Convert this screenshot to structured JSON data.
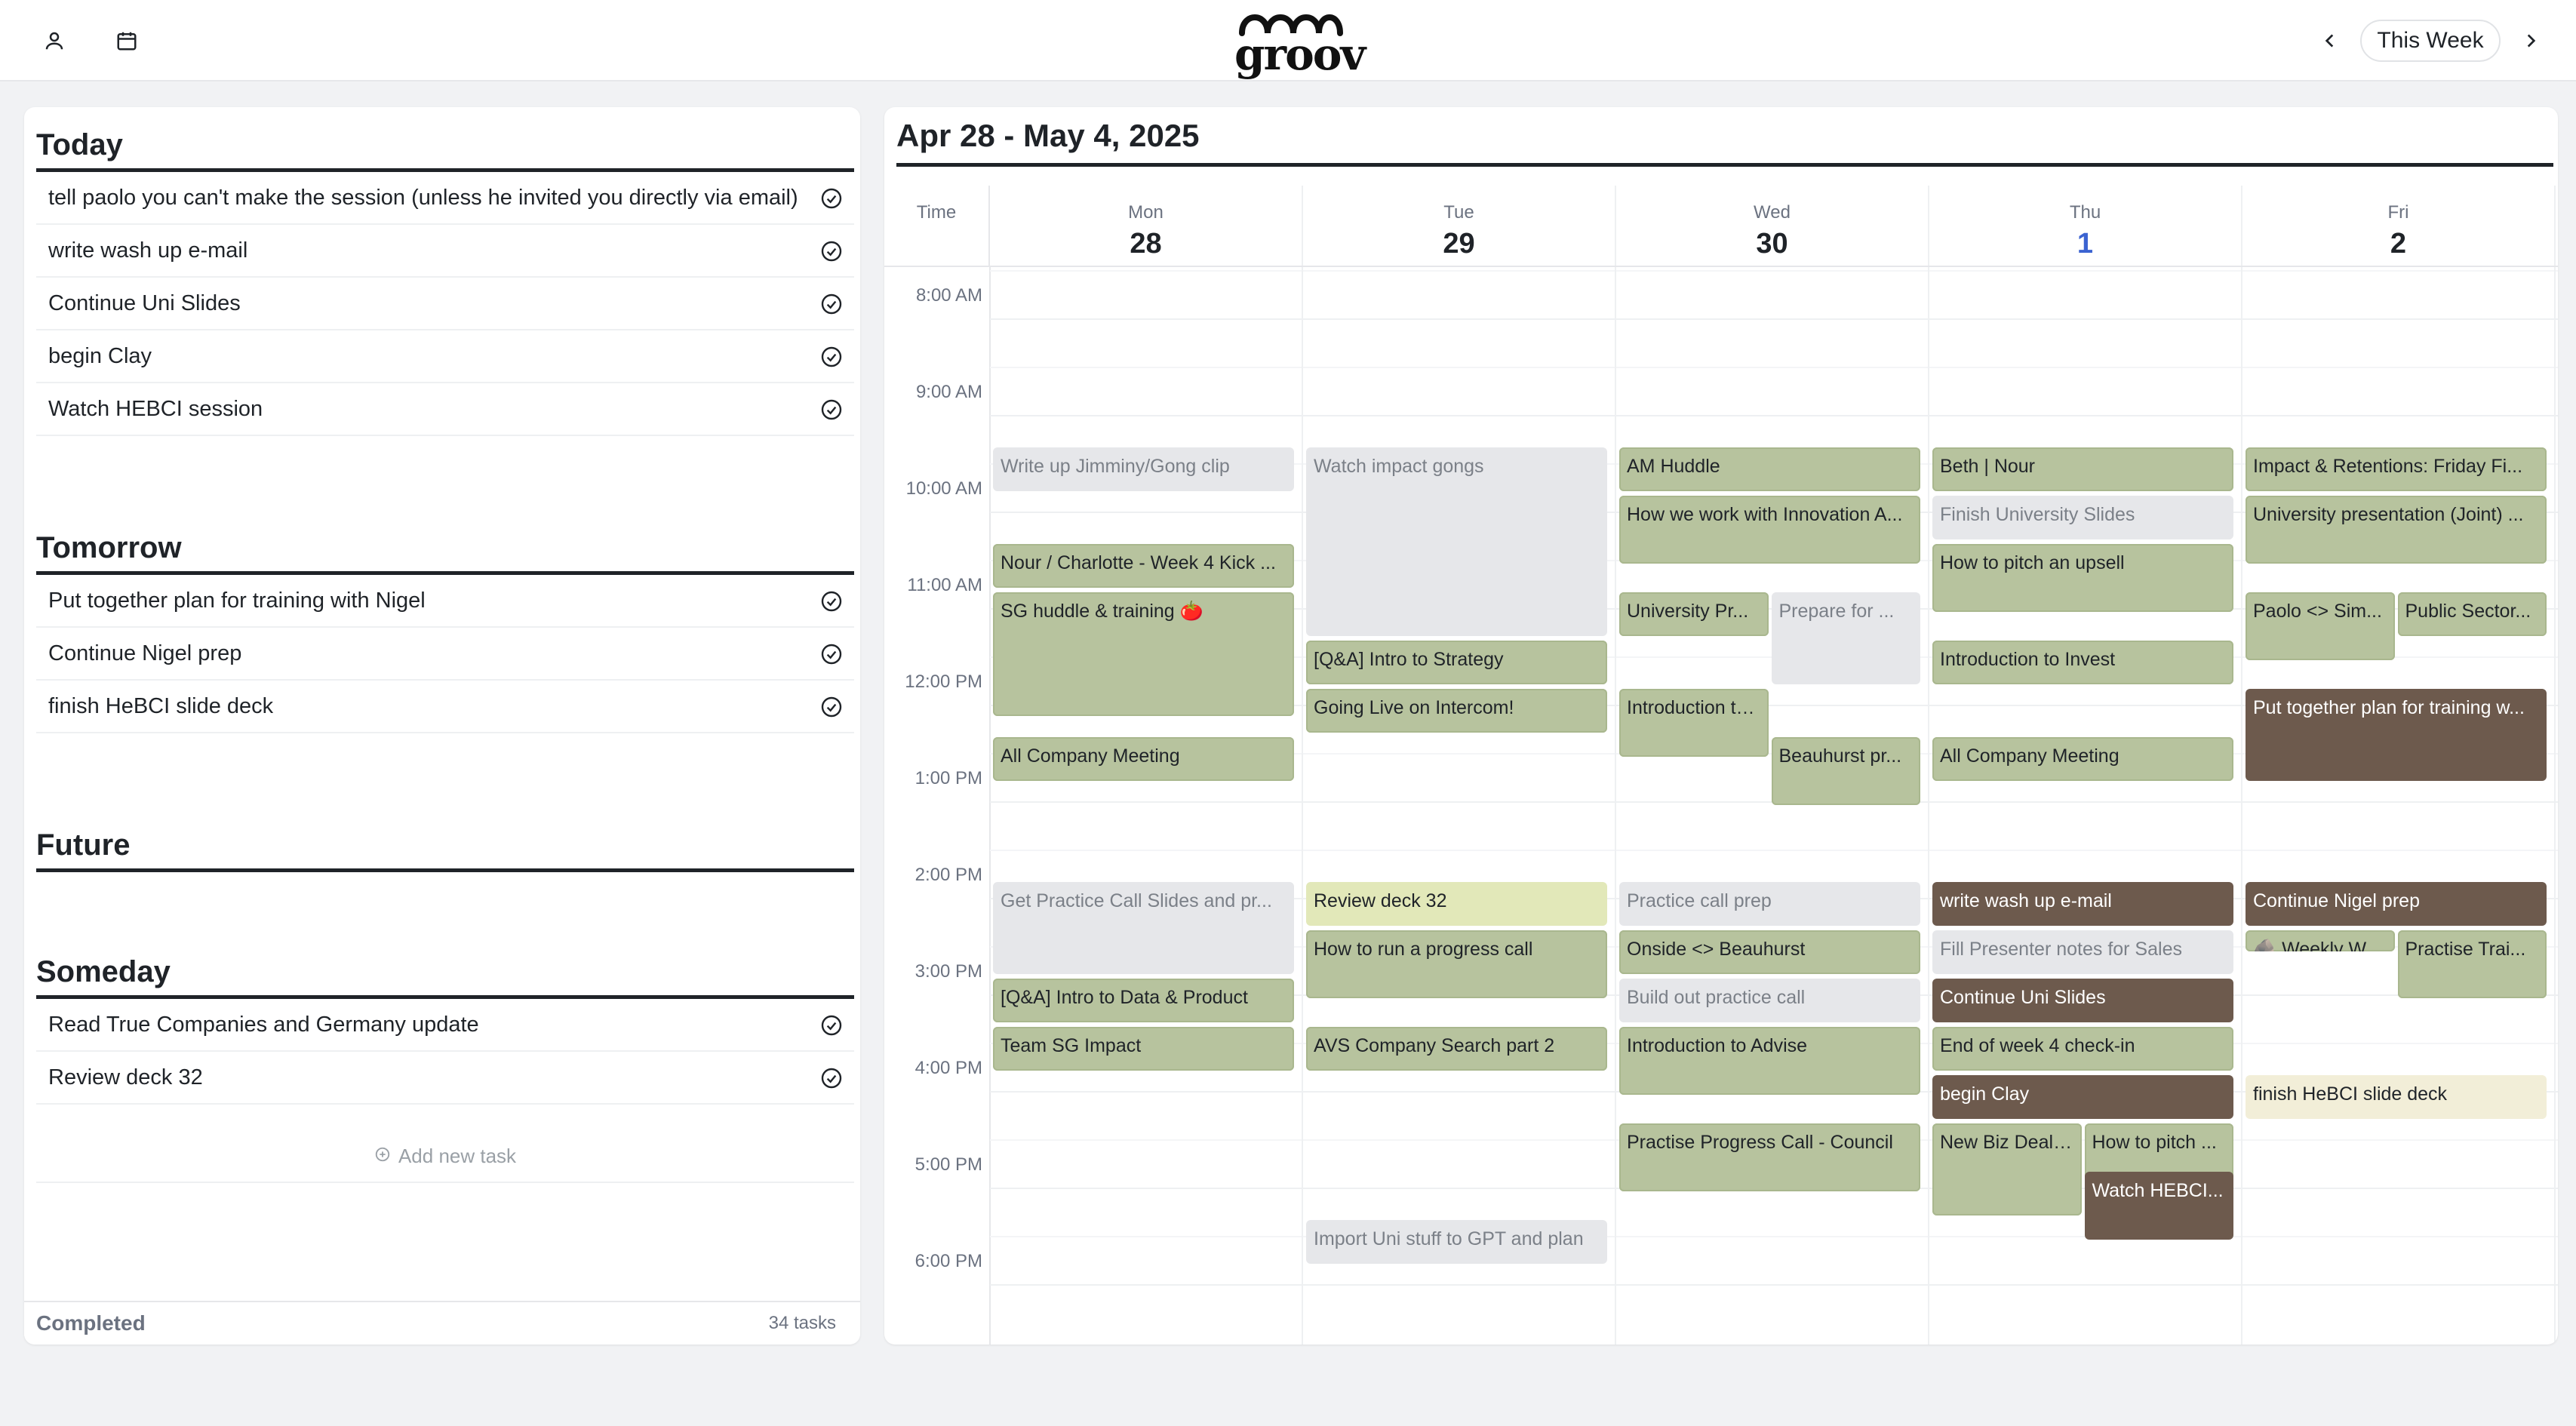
{
  "topbar": {
    "logo_text": "groov",
    "week_button": "This Week"
  },
  "colors": {
    "event_green": "#b7c39e",
    "event_gray": "#e6e7ea",
    "event_brown": "#6d5a4d",
    "event_yellow": "#e2e8b9",
    "event_cream": "#f2eed8",
    "today_accent": "#3b63d1"
  },
  "icons": {
    "profile": "person-icon",
    "calendar": "calendar-icon",
    "prev": "chevron-left-icon",
    "next": "chevron-right-icon",
    "task_check": "check-circle-icon",
    "add": "plus-circle-icon"
  },
  "tasks": {
    "today": {
      "title": "Today",
      "items": [
        "tell paolo you can't make the session (unless he invited you directly via email)",
        "write wash up e-mail",
        "Continue Uni Slides",
        "begin Clay",
        "Watch HEBCI session"
      ]
    },
    "tomorrow": {
      "title": "Tomorrow",
      "items": [
        "Put together plan for training with Nigel",
        "Continue Nigel prep",
        "finish HeBCI slide deck"
      ]
    },
    "future": {
      "title": "Future",
      "items": []
    },
    "someday": {
      "title": "Someday",
      "items": [
        "Read True Companies and Germany update",
        "Review deck 32"
      ]
    },
    "add_task_label": "Add new task",
    "completed_label": "Completed",
    "completed_count": "34 tasks"
  },
  "calendar": {
    "range_title": "Apr 28 - May 4, 2025",
    "time_header": "Time",
    "days": [
      {
        "name": "Mon",
        "num": "28"
      },
      {
        "name": "Tue",
        "num": "29"
      },
      {
        "name": "Wed",
        "num": "30"
      },
      {
        "name": "Thu",
        "num": "1"
      },
      {
        "name": "Fri",
        "num": "2"
      }
    ],
    "hours": [
      "8:00 AM",
      "9:00 AM",
      "10:00 AM",
      "11:00 AM",
      "12:00 PM",
      "1:00 PM",
      "2:00 PM",
      "3:00 PM",
      "4:00 PM",
      "5:00 PM",
      "6:00 PM"
    ],
    "events": [
      {
        "day": "Mon",
        "start": "9:00",
        "end": "9:30",
        "title": "Write up Jimminy/Gong clip",
        "color": "gray"
      },
      {
        "day": "Mon",
        "start": "10:00",
        "end": "10:30",
        "title": "Nour / Charlotte - Week 4 Kick ...",
        "color": "green"
      },
      {
        "day": "Mon",
        "start": "10:30",
        "end": "11:50",
        "title": "SG huddle & training 🍅",
        "color": "green"
      },
      {
        "day": "Mon",
        "start": "12:00",
        "end": "12:30",
        "title": "All Company Meeting",
        "color": "green"
      },
      {
        "day": "Mon",
        "start": "13:30",
        "end": "14:30",
        "title": "Get Practice Call Slides and pr...",
        "color": "gray"
      },
      {
        "day": "Mon",
        "start": "14:30",
        "end": "15:00",
        "title": "[Q&A] Intro to Data & Product",
        "color": "green"
      },
      {
        "day": "Mon",
        "start": "15:00",
        "end": "15:30",
        "title": "Team SG Impact",
        "color": "green"
      },
      {
        "day": "Tue",
        "start": "9:00",
        "end": "11:00",
        "title": "Watch impact gongs",
        "color": "gray"
      },
      {
        "day": "Tue",
        "start": "11:00",
        "end": "11:30",
        "title": "[Q&A] Intro to Strategy",
        "color": "green"
      },
      {
        "day": "Tue",
        "start": "11:30",
        "end": "12:00",
        "title": "Going Live on Intercom!",
        "color": "green"
      },
      {
        "day": "Tue",
        "start": "13:30",
        "end": "14:00",
        "title": "Review deck 32",
        "color": "yellow"
      },
      {
        "day": "Tue",
        "start": "14:00",
        "end": "14:45",
        "title": "How to run a progress call",
        "color": "green"
      },
      {
        "day": "Tue",
        "start": "15:00",
        "end": "15:30",
        "title": "AVS Company Search part 2",
        "color": "green"
      },
      {
        "day": "Tue",
        "start": "17:00",
        "end": "17:30",
        "title": "Import Uni stuff to GPT and plan",
        "color": "gray"
      },
      {
        "day": "Wed",
        "start": "9:00",
        "end": "9:30",
        "title": "AM Huddle",
        "color": "green"
      },
      {
        "day": "Wed",
        "start": "9:30",
        "end": "10:15",
        "title": "How we work with Innovation A...",
        "color": "green"
      },
      {
        "day": "Wed",
        "start": "10:30",
        "end": "11:00",
        "title": "University Pr...",
        "color": "green"
      },
      {
        "day": "Wed",
        "start": "10:30",
        "end": "11:30",
        "title": "Prepare for ...",
        "color": "gray"
      },
      {
        "day": "Wed",
        "start": "11:30",
        "end": "12:15",
        "title": "Introduction to BHSales",
        "color": "green"
      },
      {
        "day": "Wed",
        "start": "12:00",
        "end": "12:45",
        "title": "Beauhurst pr...",
        "color": "green"
      },
      {
        "day": "Wed",
        "start": "13:30",
        "end": "14:00",
        "title": "Practice call prep",
        "color": "gray"
      },
      {
        "day": "Wed",
        "start": "14:00",
        "end": "14:30",
        "title": "Onside <> Beauhurst",
        "color": "green"
      },
      {
        "day": "Wed",
        "start": "14:30",
        "end": "15:00",
        "title": "Build out practice call",
        "color": "gray"
      },
      {
        "day": "Wed",
        "start": "15:00",
        "end": "15:45",
        "title": "Introduction to Advise",
        "color": "green"
      },
      {
        "day": "Wed",
        "start": "16:00",
        "end": "16:45",
        "title": "Practise Progress Call - Council",
        "color": "green"
      },
      {
        "day": "Thu",
        "start": "9:00",
        "end": "9:30",
        "title": "Beth | Nour",
        "color": "green"
      },
      {
        "day": "Thu",
        "start": "9:30",
        "end": "10:00",
        "title": "Finish University Slides",
        "color": "gray"
      },
      {
        "day": "Thu",
        "start": "10:00",
        "end": "10:45",
        "title": "How to pitch an upsell",
        "color": "green"
      },
      {
        "day": "Thu",
        "start": "11:00",
        "end": "11:30",
        "title": "Introduction to Invest",
        "color": "green"
      },
      {
        "day": "Thu",
        "start": "12:00",
        "end": "12:30",
        "title": "All Company Meeting",
        "color": "green"
      },
      {
        "day": "Thu",
        "start": "13:30",
        "end": "14:00",
        "title": "write wash up e-mail",
        "color": "brown"
      },
      {
        "day": "Thu",
        "start": "14:00",
        "end": "14:30",
        "title": "Fill Presenter notes for Sales",
        "color": "gray"
      },
      {
        "day": "Thu",
        "start": "14:30",
        "end": "15:00",
        "title": "Continue Uni Slides",
        "color": "brown"
      },
      {
        "day": "Thu",
        "start": "15:00",
        "end": "15:30",
        "title": "End of week 4 check-in",
        "color": "green"
      },
      {
        "day": "Thu",
        "start": "15:30",
        "end": "16:00",
        "title": "begin Clay",
        "color": "brown"
      },
      {
        "day": "Thu",
        "start": "16:00",
        "end": "17:00",
        "title": "New Biz Deal ...",
        "color": "green"
      },
      {
        "day": "Thu",
        "start": "16:00",
        "end": "16:45",
        "title": "How to pitch ...",
        "color": "green"
      },
      {
        "day": "Thu",
        "start": "16:30",
        "end": "17:15",
        "title": "Watch HEBCI...",
        "color": "brown"
      },
      {
        "day": "Fri",
        "start": "9:00",
        "end": "9:30",
        "title": "Impact & Retentions: Friday Fi...",
        "color": "green"
      },
      {
        "day": "Fri",
        "start": "9:30",
        "end": "10:15",
        "title": "University presentation (Joint) ...",
        "color": "green"
      },
      {
        "day": "Fri",
        "start": "10:30",
        "end": "11:15",
        "title": "Paolo <> Sim...",
        "color": "green"
      },
      {
        "day": "Fri",
        "start": "10:30",
        "end": "11:00",
        "title": "Public Sector...",
        "color": "green"
      },
      {
        "day": "Fri",
        "start": "11:30",
        "end": "12:30",
        "title": "Put together plan for training w...",
        "color": "brown"
      },
      {
        "day": "Fri",
        "start": "13:30",
        "end": "14:00",
        "title": "Continue Nigel prep",
        "color": "brown"
      },
      {
        "day": "Fri",
        "start": "14:00",
        "end": "14:15",
        "title": "🪨 Weekly W...",
        "color": "green"
      },
      {
        "day": "Fri",
        "start": "14:00",
        "end": "14:45",
        "title": "Practise Trai...",
        "color": "green"
      },
      {
        "day": "Fri",
        "start": "15:30",
        "end": "16:00",
        "title": "finish HeBCI slide deck",
        "color": "cream"
      }
    ]
  }
}
